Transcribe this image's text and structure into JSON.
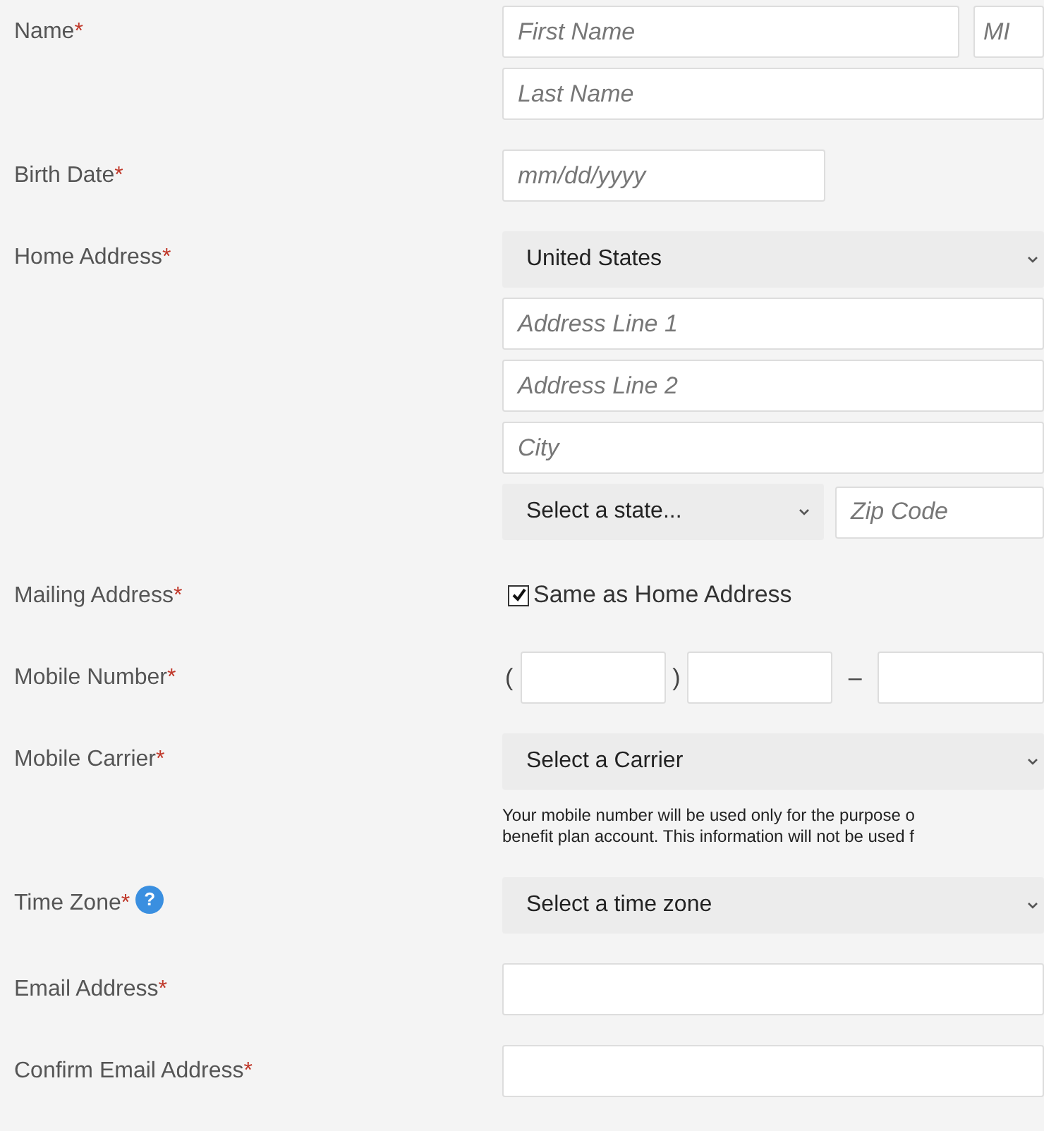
{
  "rows": [
    {
      "label": "Name",
      "mark": "*",
      "lines": [
        {
          "kind": "pair",
          "items": [
            {
              "kind": "input",
              "placeholder": "First Name"
            },
            {
              "kind": "input",
              "placeholder": "MI"
            }
          ]
        },
        {
          "kind": "full",
          "items": [
            {
              "kind": "input",
              "placeholder": "Last Name"
            }
          ]
        }
      ]
    },
    {
      "label": "Birth Date",
      "mark": "*",
      "lines": [
        {
          "kind": "short",
          "items": [
            {
              "kind": "input",
              "placeholder": "mm/dd/yyyy"
            }
          ]
        }
      ]
    },
    {
      "label": "Home Address",
      "mark": "*",
      "lines": [
        {
          "kind": "full",
          "items": [
            {
              "kind": "select",
              "value": "United States"
            }
          ]
        },
        {
          "kind": "full",
          "items": [
            {
              "kind": "input",
              "placeholder": "Address Line 1"
            }
          ]
        },
        {
          "kind": "full",
          "items": [
            {
              "kind": "input",
              "placeholder": "Address Line 2"
            }
          ]
        },
        {
          "kind": "full",
          "items": [
            {
              "kind": "input",
              "placeholder": "City"
            }
          ]
        },
        {
          "kind": "split",
          "items": [
            {
              "kind": "select",
              "value": "Select a state..."
            },
            {
              "kind": "input",
              "placeholder": "Zip Code"
            }
          ]
        }
      ]
    },
    {
      "label": "Mailing Address",
      "mark": "*",
      "lines": [
        {
          "kind": "full",
          "items": [
            {
              "kind": "checkbox",
              "label": "Same as Home Address",
              "checked": true
            }
          ]
        }
      ]
    },
    {
      "label": "Mobile Number",
      "mark": "*",
      "lines": [
        {
          "kind": "phone",
          "items": [
            {
              "kind": "symbol",
              "text": "("
            },
            {
              "kind": "input"
            },
            {
              "kind": "symbol",
              "text": ")"
            },
            {
              "kind": "input"
            },
            {
              "kind": "symbol",
              "text": "–"
            },
            {
              "kind": "input"
            }
          ]
        }
      ]
    },
    {
      "label": "Mobile Carrier",
      "mark": "*",
      "lines": [
        {
          "kind": "full",
          "items": [
            {
              "kind": "select",
              "value": "Select a Carrier"
            }
          ]
        },
        {
          "kind": "full",
          "items": [
            {
              "kind": "note",
              "lines": [
                "Your mobile number will be used only for the purpose o",
                "benefit plan account. This information will not be used f"
              ]
            }
          ]
        }
      ]
    },
    {
      "label": "Time Zone",
      "mark": "*",
      "help": "?",
      "lines": [
        {
          "kind": "full",
          "items": [
            {
              "kind": "select",
              "value": "Select a time zone"
            }
          ]
        }
      ]
    },
    {
      "label": "Email Address",
      "mark": "*",
      "lines": [
        {
          "kind": "full",
          "items": [
            {
              "kind": "input"
            }
          ]
        }
      ]
    },
    {
      "label": "Confirm Email Address",
      "mark": "*",
      "lines": [
        {
          "kind": "full",
          "items": [
            {
              "kind": "input"
            }
          ]
        }
      ]
    }
  ]
}
